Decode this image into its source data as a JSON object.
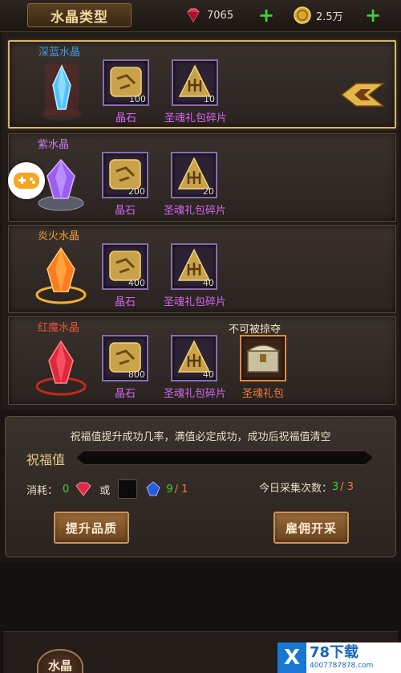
{
  "header": {
    "title": "水晶类型",
    "gems": "7065",
    "coins": "2.5万"
  },
  "crystals": [
    {
      "name": "深蓝水晶",
      "name_color": "#3f9be6",
      "crystal_color": "#4fc3ff",
      "stone_label": "晶石",
      "stone_count": "100",
      "fragment_label": "圣魂礼包碎片",
      "fragment_count": "10",
      "selected": true
    },
    {
      "name": "紫水晶",
      "visible_name": "紫水晶",
      "name_color": "#c77cf0",
      "crystal_color": "#9b5ef0",
      "stone_label": "晶石",
      "stone_count": "200",
      "fragment_label": "圣魂礼包碎片",
      "fragment_count": "20",
      "selected": false
    },
    {
      "name": "炎火水晶",
      "name_color": "#f0a030",
      "crystal_color": "#ff7a20",
      "stone_label": "晶石",
      "stone_count": "400",
      "fragment_label": "圣魂礼包碎片",
      "fragment_count": "40",
      "selected": false
    },
    {
      "name": "红魔水晶",
      "name_color": "#e6503a",
      "crystal_color": "#e0283a",
      "stone_label": "晶石",
      "stone_count": "800",
      "fragment_label": "圣魂礼包碎片",
      "fragment_count": "40",
      "extra_tag": "不可被掠夺",
      "extra_label": "圣魂礼包",
      "selected": false
    }
  ],
  "panel": {
    "hint": "祝福值提升成功几率，满值必定成功，成功后祝福值清空",
    "bless_label": "祝福值",
    "cost_label": "消耗：",
    "cost_ruby": "0",
    "or_label": "或",
    "sapphire_have": "9",
    "sapphire_need": "/ 1",
    "daily_label": "今日采集次数：",
    "daily_used": "3",
    "daily_total": "/ 3",
    "upgrade_button": "提升品质",
    "hire_button": "雇佣开采"
  },
  "bottom_tab": "水晶",
  "watermark": {
    "title": "78下载",
    "url": "4007787878.com"
  }
}
